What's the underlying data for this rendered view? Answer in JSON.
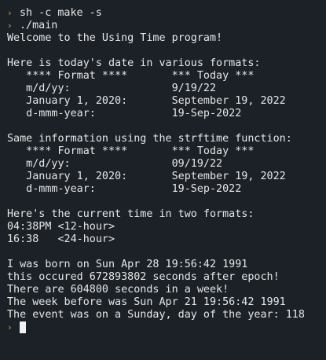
{
  "terminal": {
    "prompt_symbol": "›",
    "command_1": "sh -c make -s",
    "command_2": "./main",
    "output": [
      "Welcome to the Using Time program!",
      "",
      "Here is today's date in various formats:",
      "   **** Format ****       *** Today ***",
      "   m/d/yy:                9/19/22",
      "   January 1, 2020:       September 19, 2022",
      "   d-mmm-year:            19-Sep-2022",
      "",
      "Same information using the strftime function:",
      "   **** Format ****       *** Today ***",
      "   m/d/yy:                09/19/22",
      "   January 1, 2020:       September 19, 2022",
      "   d-mmm-year:            19-Sep-2022",
      "",
      "Here's the current time in two formats:",
      "04:38PM <12-hour>",
      "16:38   <24-hour>",
      "",
      "I was born on Sun Apr 28 19:56:42 1991",
      "this occured 672893802 seconds after epoch!",
      "There are 604800 seconds in a week!",
      "The week before was Sun Apr 21 19:56:42 1991",
      "The event was on a Sunday, day of the year: 118"
    ]
  },
  "colors": {
    "background": "#1c2128",
    "text": "#e6e6e6",
    "prompt": "#e8a33a",
    "cursor": "#f2f2f2"
  }
}
